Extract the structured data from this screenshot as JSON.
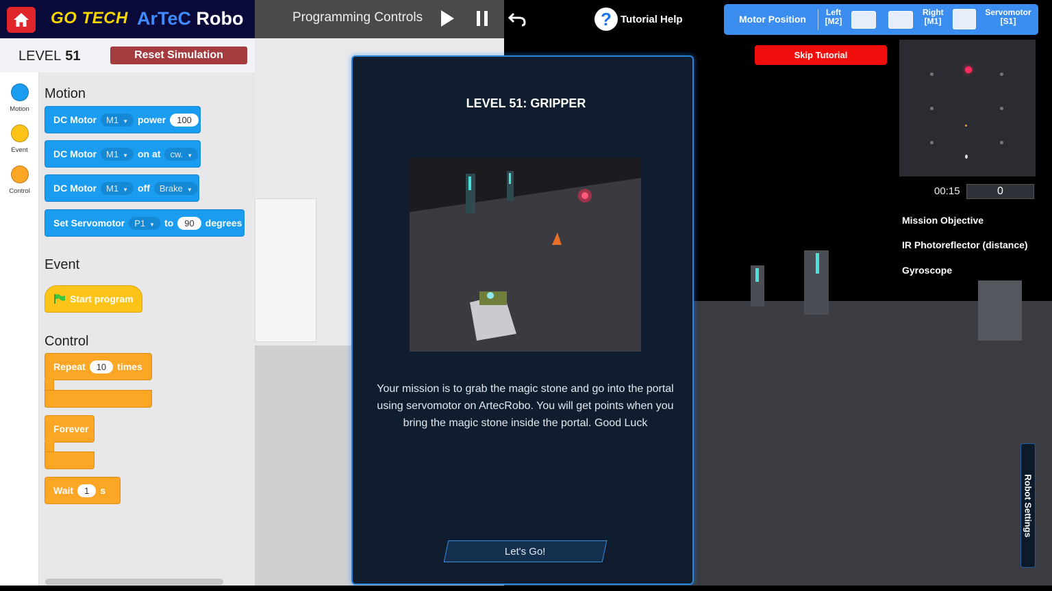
{
  "header": {
    "brand_gotech": "GO TECH",
    "brand_artec_1": "ArTeC",
    "brand_artec_2": "Robo",
    "program_title": "Programming Controls",
    "tutorial_help": "Tutorial Help"
  },
  "level": {
    "label": "LEVEL",
    "number": "51",
    "reset_label": "Reset Simulation"
  },
  "categories": [
    {
      "label": "Motion",
      "color": "#1a9cf0"
    },
    {
      "label": "Event",
      "color": "#fcc419"
    },
    {
      "label": "Control",
      "color": "#fca626"
    }
  ],
  "palette": {
    "motion_title": "Motion",
    "event_title": "Event",
    "control_title": "Control",
    "blocks": {
      "dc_power": {
        "label": "DC Motor",
        "motor": "M1",
        "word": "power",
        "value": "100"
      },
      "dc_on": {
        "label": "DC Motor",
        "motor": "M1",
        "word": "on at",
        "dir": "cw."
      },
      "dc_off": {
        "label": "DC Motor",
        "motor": "M1",
        "word": "off",
        "mode": "Brake"
      },
      "servo": {
        "label": "Set Servomotor",
        "port": "P1",
        "word": "to",
        "value": "90",
        "unit": "degrees"
      },
      "start": {
        "label": "Start program"
      },
      "repeat": {
        "label": "Repeat",
        "value": "10",
        "unit": "times"
      },
      "forever": {
        "label": "Forever"
      },
      "wait": {
        "label": "Wait",
        "value": "1",
        "unit": "s"
      }
    }
  },
  "motor_panel": {
    "title": "Motor Position",
    "left_label": "Left",
    "left_port": "[M2]",
    "right_label": "Right",
    "right_port": "[M1]",
    "servo_label": "Servomotor",
    "servo_port": "[S1]"
  },
  "skip_tutorial": "Skip Tutorial",
  "status": {
    "timer": "00:15",
    "score": "0"
  },
  "sensors": [
    "Mission Objective",
    "IR Photoreflector (distance)",
    "Gyroscope"
  ],
  "robot_settings": "Robot Settings",
  "modal": {
    "title": "LEVEL 51: GRIPPER",
    "description": "Your mission is to grab the magic stone and go into the portal using servomotor on ArtecRobo. You will get points when you bring the magic stone inside the portal. Good Luck",
    "button": "Let's Go!"
  }
}
